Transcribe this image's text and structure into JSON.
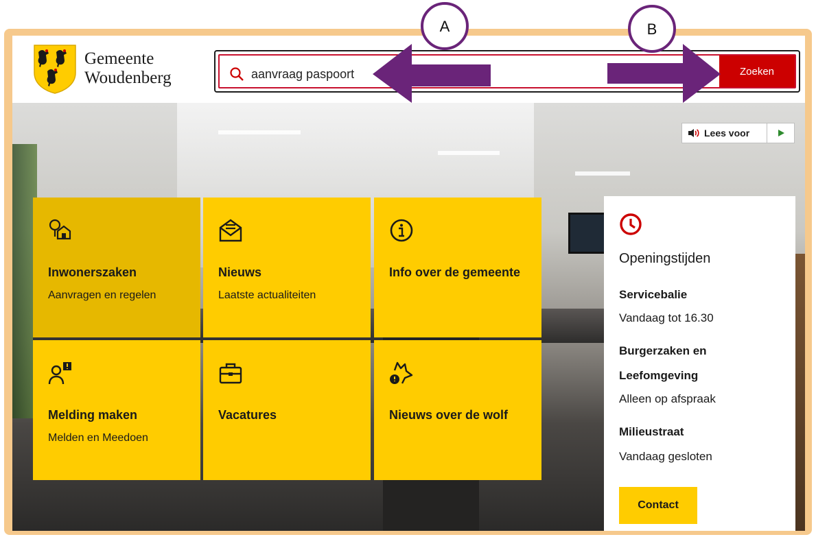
{
  "header": {
    "logo_line1": "Gemeente",
    "logo_line2": "Woudenberg",
    "search_value": "aanvraag paspoort",
    "search_button": "Zoeken"
  },
  "lees_voor": {
    "label": "Lees voor"
  },
  "tiles": [
    {
      "title": "Inwonerszaken",
      "subtitle": "Aanvragen en regelen",
      "icon": "house-tree-icon"
    },
    {
      "title": "Nieuws",
      "subtitle": "Laatste actualiteiten",
      "icon": "envelope-news-icon"
    },
    {
      "title": "Info over de gemeente",
      "subtitle": "",
      "icon": "info-icon"
    },
    {
      "title": "Melding maken",
      "subtitle": "Melden en Meedoen",
      "icon": "person-alert-icon"
    },
    {
      "title": "Vacatures",
      "subtitle": "",
      "icon": "briefcase-icon"
    },
    {
      "title": "Nieuws over de wolf",
      "subtitle": "",
      "icon": "wolf-icon"
    }
  ],
  "opening": {
    "title": "Openingstijden",
    "items": [
      {
        "name": "Servicebalie",
        "value": "Vandaag tot 16.30"
      },
      {
        "name": "Burgerzaken en Leefomgeving",
        "value": "Alleen op afspraak"
      },
      {
        "name": "Milieustraat",
        "value": "Vandaag gesloten"
      }
    ],
    "contact_button": "Contact"
  },
  "annotations": {
    "a_label": "A",
    "b_label": "B",
    "arrow_color": "#6a2479"
  },
  "colors": {
    "accent_yellow": "#ffcc00",
    "search_red": "#cc0000",
    "frame": "#f6c98c"
  }
}
